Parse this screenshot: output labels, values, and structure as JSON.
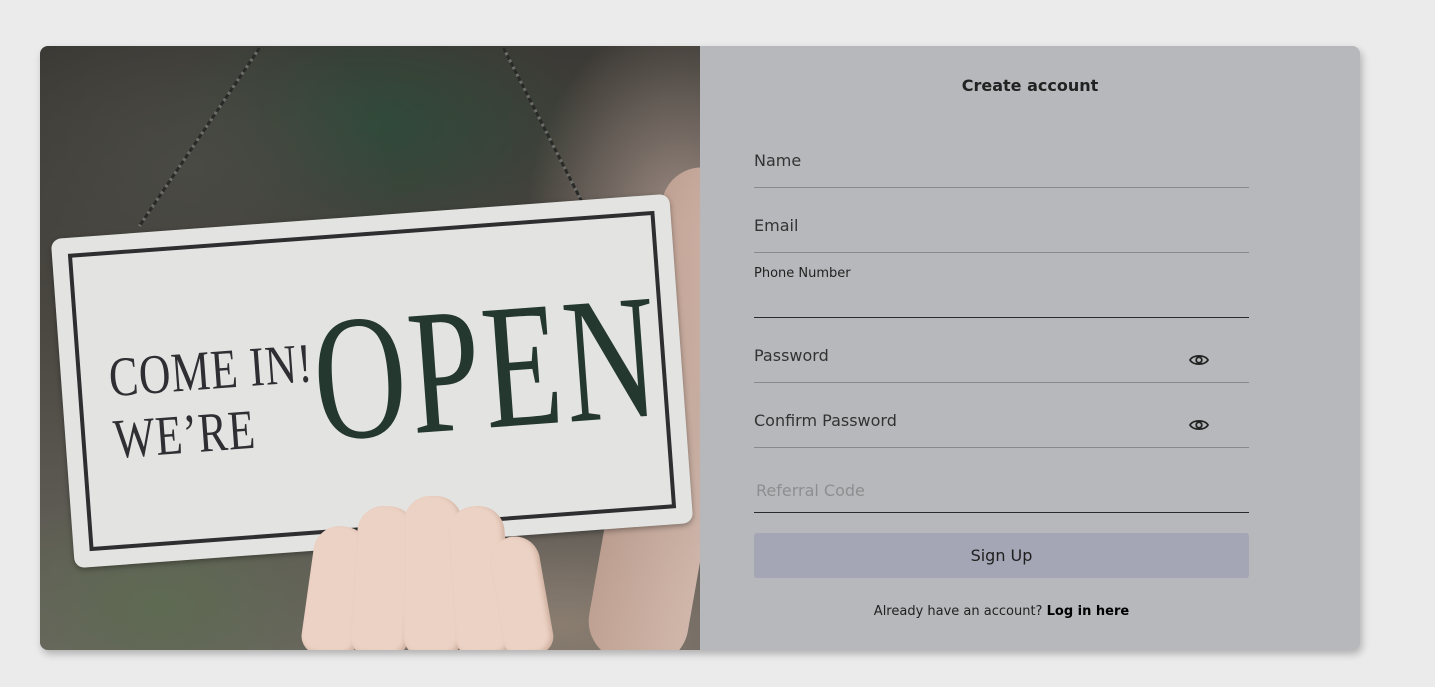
{
  "form": {
    "title": "Create account",
    "fields": {
      "name": {
        "label": "Name"
      },
      "email": {
        "label": "Email"
      },
      "phone": {
        "label": "Phone Number"
      },
      "password": {
        "label": "Password"
      },
      "confirm_password": {
        "label": "Confirm Password"
      },
      "referral": {
        "placeholder": "Referral Code"
      }
    },
    "submit_label": "Sign Up",
    "footer_text": "Already have an account?",
    "footer_link": "Log in here"
  },
  "photo": {
    "sign_small_line1": "COME IN!",
    "sign_small_line2": "WE’RE",
    "sign_big": "OPEN"
  },
  "icons": {
    "password_toggle": "eye-icon",
    "confirm_password_toggle": "eye-icon"
  },
  "colors": {
    "page_bg": "#ebebeb",
    "panel_bg": "#b7b8bb",
    "button_bg": "#a4a5b5"
  }
}
